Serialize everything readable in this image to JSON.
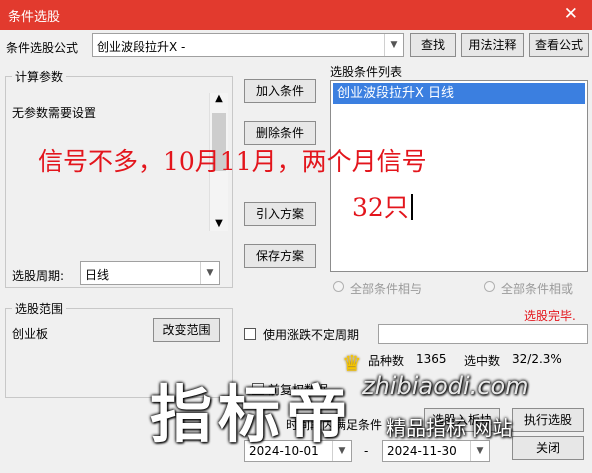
{
  "window": {
    "title": "条件选股",
    "close_glyph": "✕"
  },
  "formula": {
    "label": "条件选股公式",
    "value": "创业波段拉升X  -",
    "buttons": {
      "find": "查找",
      "usage": "用法注释",
      "view": "查看公式"
    }
  },
  "params": {
    "legend": "计算参数",
    "text": "无参数需要设置"
  },
  "period": {
    "label": "选股周期:",
    "value": "日线"
  },
  "actions": {
    "add": "加入条件",
    "delete": "删除条件",
    "import": "引入方案",
    "save": "保存方案"
  },
  "conditions": {
    "legend": "选股条件列表",
    "items": [
      {
        "label": "创业波段拉升X  日线"
      }
    ]
  },
  "logic": {
    "and": "全部条件相与",
    "or": "全部条件相或"
  },
  "status": {
    "text": "选股完毕.",
    "color": "#e3151c"
  },
  "scope": {
    "legend": "选股范围",
    "value": "创业板",
    "change_button": "改变范围"
  },
  "undetermined_period": {
    "label": "使用涨跌不定周期"
  },
  "stats": {
    "count_label": "品种数",
    "count_value": "1365",
    "selected_label": "选中数",
    "selected_value": "32/2.3%"
  },
  "rights": {
    "label": "前复权数据"
  },
  "range": {
    "label": "时间段内满足条件",
    "start": "2024-10-01",
    "separator": "-",
    "end": "2024-11-30"
  },
  "bottom_buttons": {
    "select_to_block": "选股入板块",
    "execute": "执行选股",
    "close": "关闭"
  },
  "annotation": {
    "line1": "信号不多，10月11月，两个月信号",
    "line2": "32只"
  },
  "watermark": {
    "big": "指标帝",
    "url": "zhibiaodi.com",
    "small": "精品指标 网站"
  },
  "icons": {
    "dropdown": "chevron-down-icon",
    "scroll_up": "up-arrow-icon",
    "scroll_down": "down-arrow-icon",
    "crown": "crown-icon"
  }
}
